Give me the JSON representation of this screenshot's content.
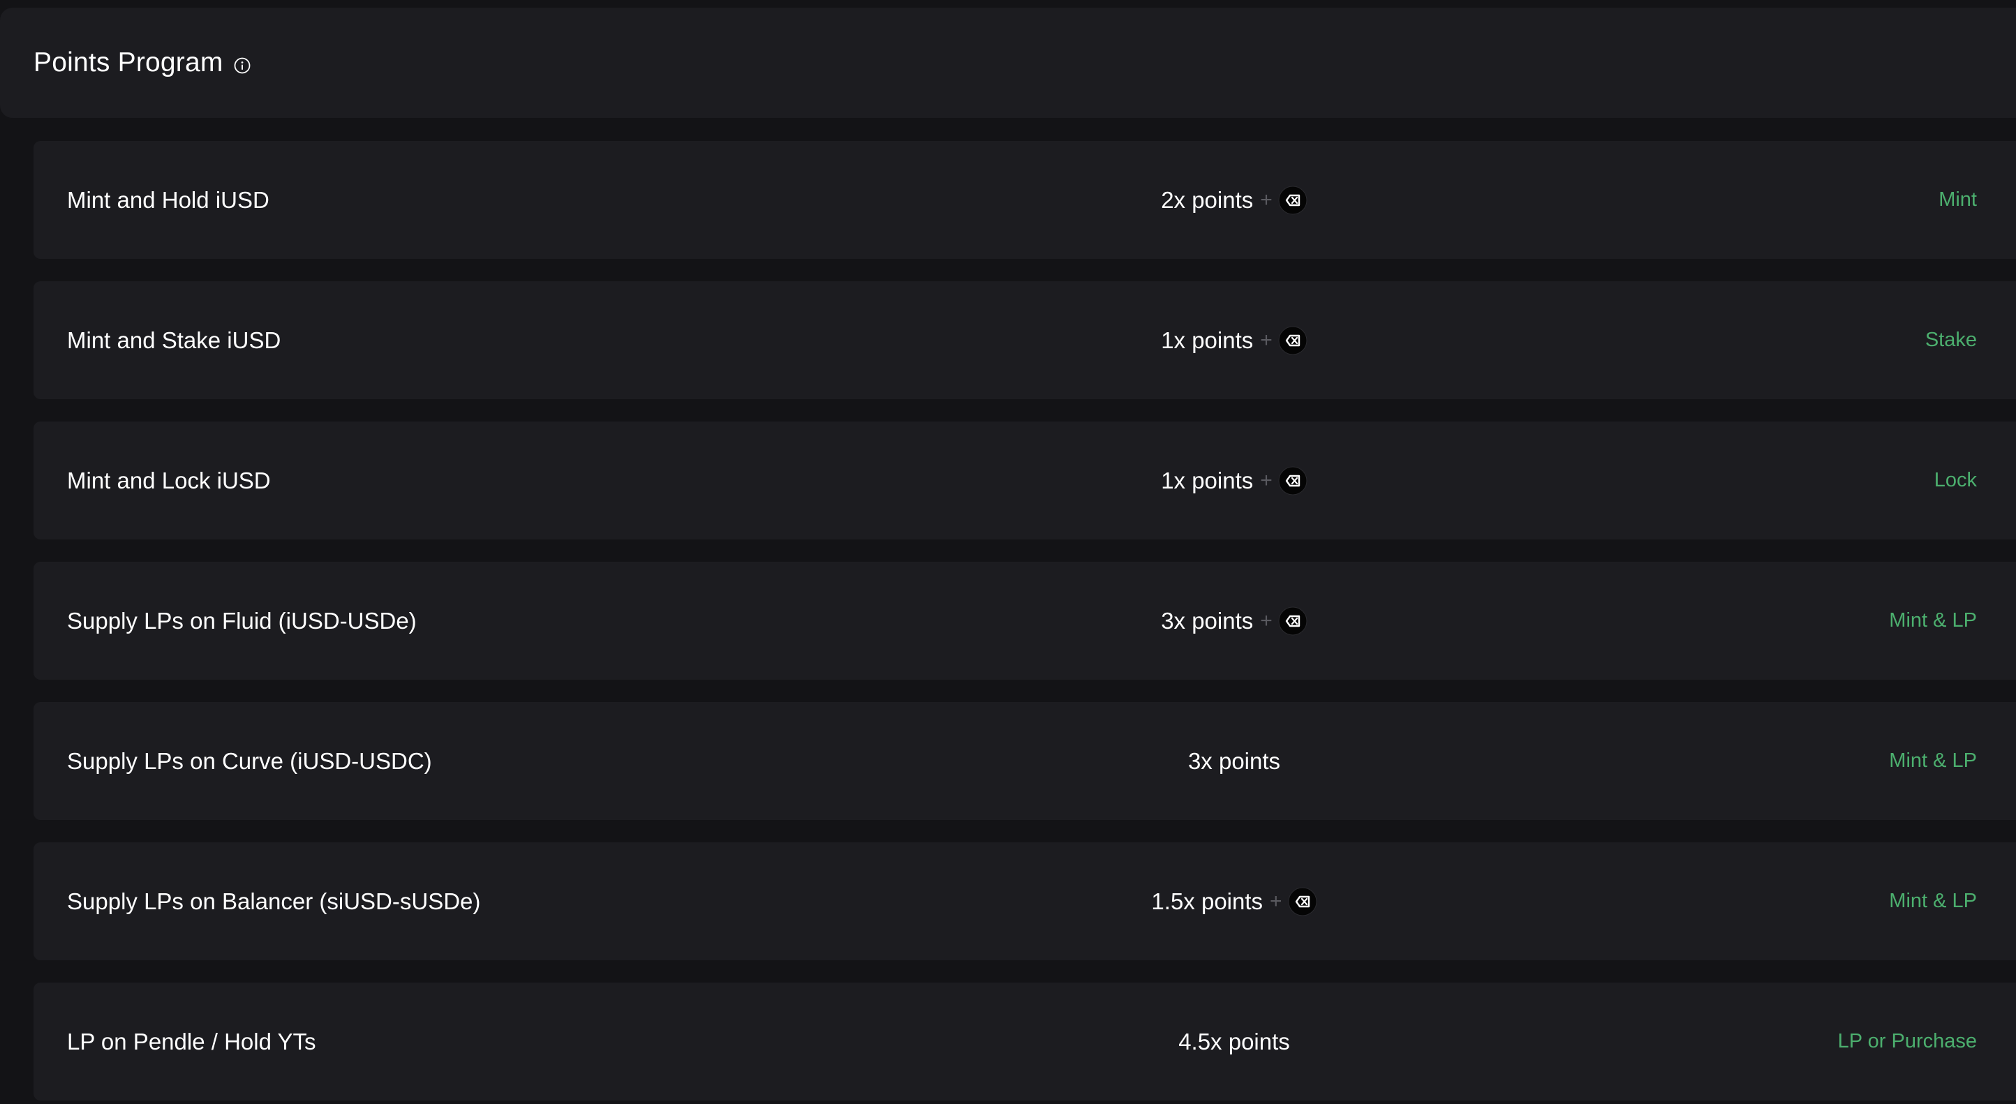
{
  "header": {
    "title": "Points Program"
  },
  "icons": {
    "info": "info-circle-icon",
    "token": "partner-token-icon"
  },
  "colors": {
    "background": "#131316",
    "card": "#1c1c20",
    "accent": "#4caf6e",
    "plus": "#5a5a60"
  },
  "rows": [
    {
      "title": "Mint and Hold iUSD",
      "points": "2x points",
      "plus": "+",
      "action": "Mint"
    },
    {
      "title": "Mint and Stake iUSD",
      "points": "1x points",
      "plus": "+",
      "action": "Stake"
    },
    {
      "title": "Mint and Lock iUSD",
      "points": "1x points",
      "plus": "+",
      "action": "Lock"
    },
    {
      "title": "Supply LPs on Fluid (iUSD-USDe)",
      "points": "3x points",
      "plus": "+",
      "action": "Mint & LP"
    },
    {
      "title": "Supply LPs on Curve (iUSD-USDC)",
      "points": "3x points",
      "plus": "",
      "action": "Mint & LP"
    },
    {
      "title": "Supply LPs on Balancer (siUSD-sUSDe)",
      "points": "1.5x points",
      "plus": "+",
      "action": "Mint & LP"
    },
    {
      "title": "LP on Pendle / Hold YTs",
      "points": "4.5x points",
      "plus": "",
      "action": "LP or Purchase"
    }
  ]
}
